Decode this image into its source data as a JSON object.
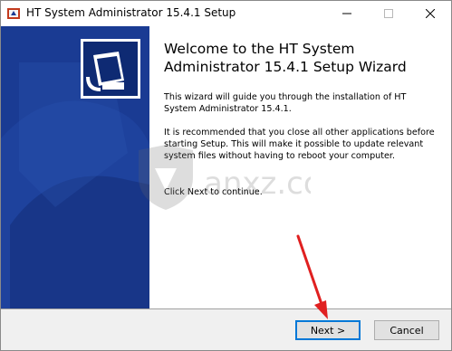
{
  "window": {
    "title": "HT System Administrator 15.4.1 Setup"
  },
  "titlebar": {
    "minimize_icon": "minimize-icon",
    "maximize_icon": "maximize-icon",
    "close_icon": "close-icon"
  },
  "content": {
    "heading": "Welcome to the HT System Administrator 15.4.1 Setup Wizard",
    "intro": "This wizard will guide you through the installation of HT System Administrator 15.4.1.",
    "recommendation": "It is recommended that you close all other applications before starting Setup. This will make it possible to update relevant system files without having to reboot your computer.",
    "continue_hint": "Click Next to continue."
  },
  "buttons": {
    "next": "Next >",
    "cancel": "Cancel"
  },
  "watermark": {
    "text": "anxz.com"
  },
  "colors": {
    "sidebar": "#1a3b93",
    "annotation_arrow": "#e02020",
    "focus_border": "#0078d7"
  }
}
